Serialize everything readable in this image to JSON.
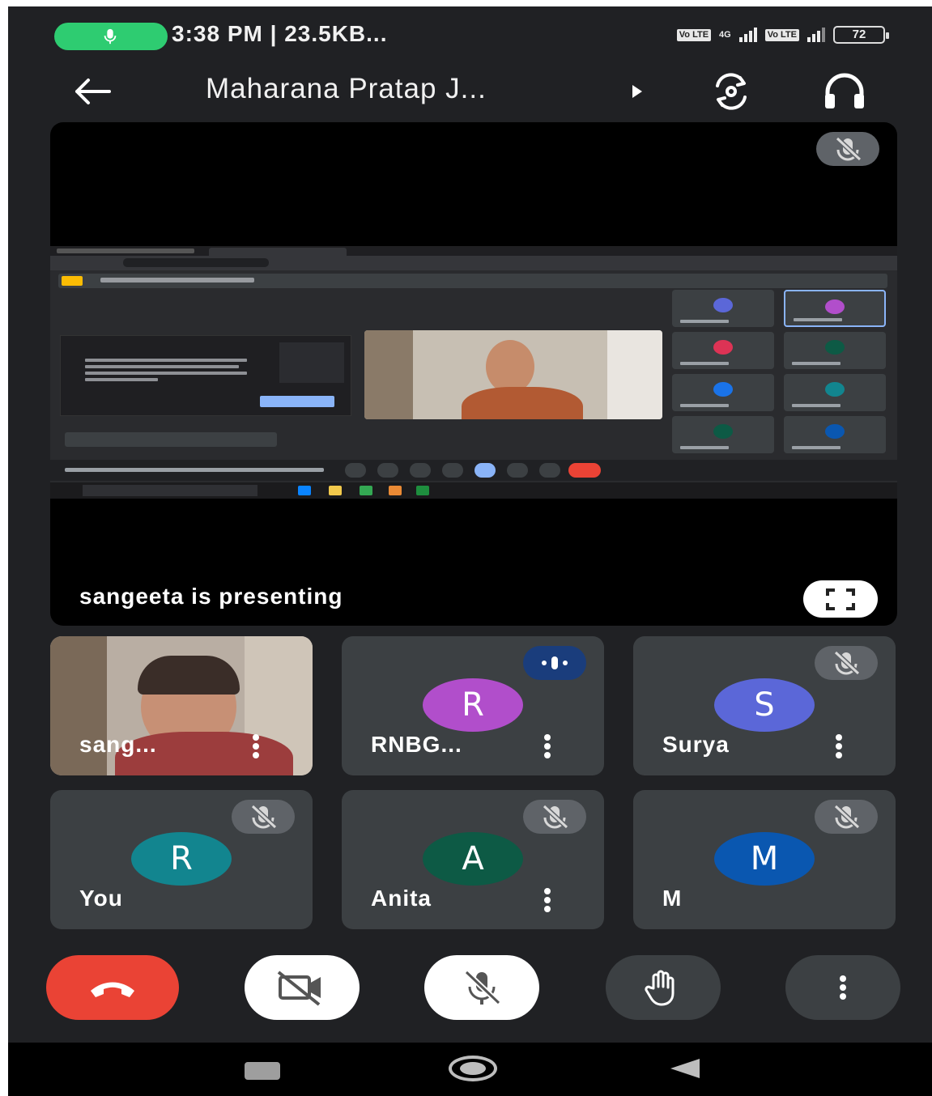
{
  "status_bar": {
    "status_text": "3:38 PM | 23.5KB...",
    "network_1": "4G",
    "volte_label": "Vo LTE",
    "battery": "72"
  },
  "app_bar": {
    "meeting_title": "Maharana Pratap J..."
  },
  "presentation": {
    "presenting_label": "sangeeta is presenting"
  },
  "participants": [
    {
      "name": "sang...",
      "initial": "",
      "state": "video",
      "avatar_color": ""
    },
    {
      "name": "RNBG...",
      "initial": "R",
      "state": "speaking",
      "avatar_color": "#b14ecb"
    },
    {
      "name": "Surya",
      "initial": "S",
      "state": "muted",
      "avatar_color": "#5b67d8"
    },
    {
      "name": "You",
      "initial": "R",
      "state": "muted",
      "avatar_color": "#12858f"
    },
    {
      "name": "Anita",
      "initial": "A",
      "state": "muted",
      "avatar_color": "#0d5a45"
    },
    {
      "name": "M",
      "initial": "M",
      "state": "muted",
      "avatar_color": "#0a57b0"
    }
  ],
  "controls": {
    "end_call": "end-call-icon",
    "camera": "camera-off-icon",
    "mic": "mic-off-icon",
    "raise_hand": "hand-icon",
    "more": "more-vert-icon"
  },
  "colors": {
    "end_call_red": "#ea4335",
    "background": "#202124",
    "tile": "#3c4043",
    "call_pill_green": "#2ecc71"
  }
}
